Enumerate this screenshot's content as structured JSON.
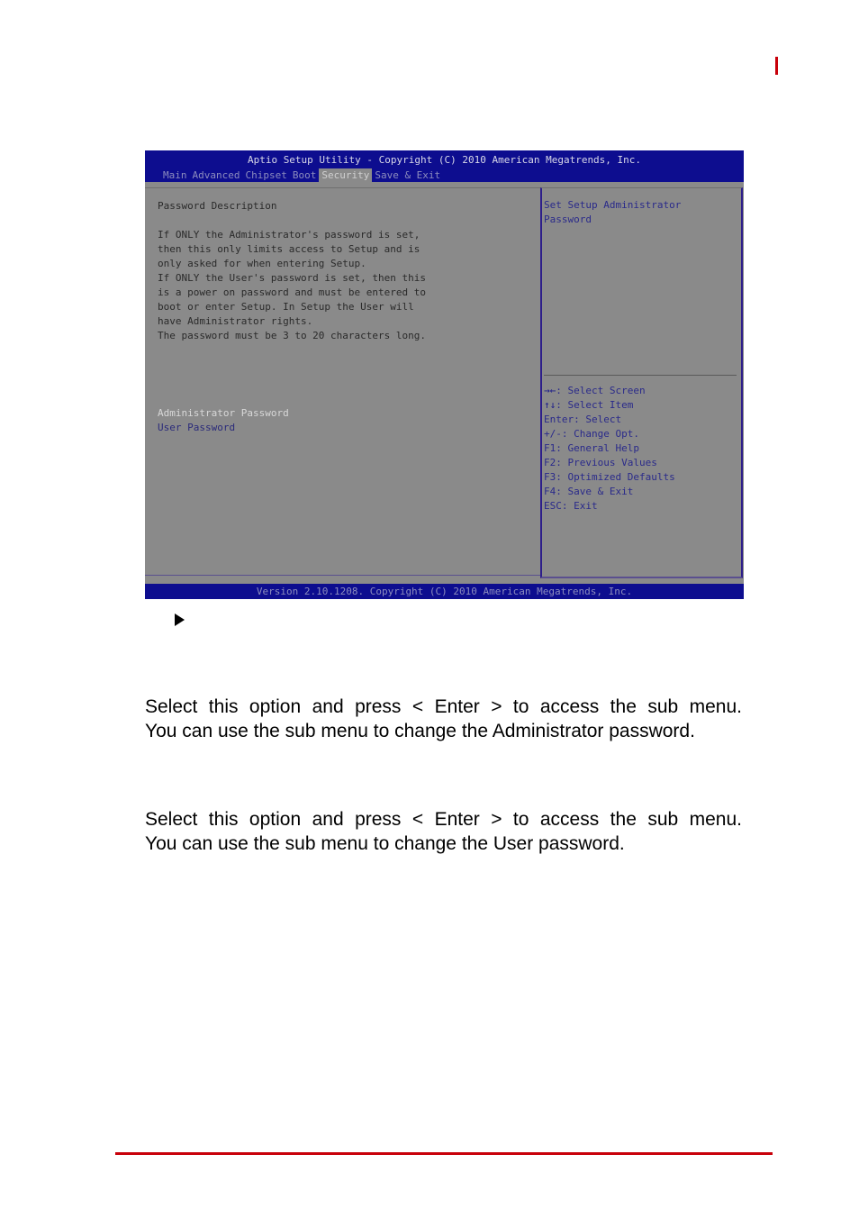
{
  "page": {
    "accent_color": "#c8000a"
  },
  "bios": {
    "title": "Aptio Setup Utility - Copyright (C) 2010 American Megatrends, Inc.",
    "tabs": [
      {
        "label": "Main",
        "active": false
      },
      {
        "label": "Advanced",
        "active": false
      },
      {
        "label": "Chipset",
        "active": false
      },
      {
        "label": "Boot",
        "active": false
      },
      {
        "label": "Security",
        "active": true
      },
      {
        "label": "Save & Exit",
        "active": false
      }
    ],
    "description_lines": [
      "Password Description",
      "",
      "If ONLY the Administrator's password is set,",
      "then this only limits access to Setup and is",
      "only asked for when entering Setup.",
      "If ONLY the User's password is set, then this",
      "is a power on password and must be entered to",
      "boot or enter Setup. In Setup the User will",
      "have Administrator rights.",
      "The password must be 3 to 20 characters long."
    ],
    "menu_items": [
      {
        "label": "Administrator Password",
        "selected": true
      },
      {
        "label": "User Password",
        "selected": false
      }
    ],
    "help_text": "Set Setup Administrator\nPassword",
    "keys": [
      {
        "key": "→←",
        "action": ": Select Screen"
      },
      {
        "key": "↑↓",
        "action": ": Select Item"
      },
      {
        "key": "Enter",
        "action": ": Select"
      },
      {
        "key": "+/-",
        "action": ": Change Opt."
      },
      {
        "key": "F1",
        "action": ": General Help"
      },
      {
        "key": "F2",
        "action": ": Previous Values"
      },
      {
        "key": "F3",
        "action": ": Optimized Defaults"
      },
      {
        "key": "F4",
        "action": ": Save & Exit"
      },
      {
        "key": "ESC",
        "action": ": Exit"
      }
    ],
    "version": "Version 2.10.1208. Copyright (C) 2010 American Megatrends, Inc.",
    "colors": {
      "header_blue": "#0d0d8f",
      "panel_gray": "#8a8a8a"
    }
  },
  "body": {
    "bullet_icon": "right-triangle",
    "para1": {
      "line1": "Select this option and press < Enter > to access the sub menu.",
      "line2": "You can use the sub menu to change the Administrator password."
    },
    "para2": {
      "line1": "Select this option and press < Enter > to access the sub menu.",
      "line2": "You can use the sub menu to change the User password."
    }
  }
}
